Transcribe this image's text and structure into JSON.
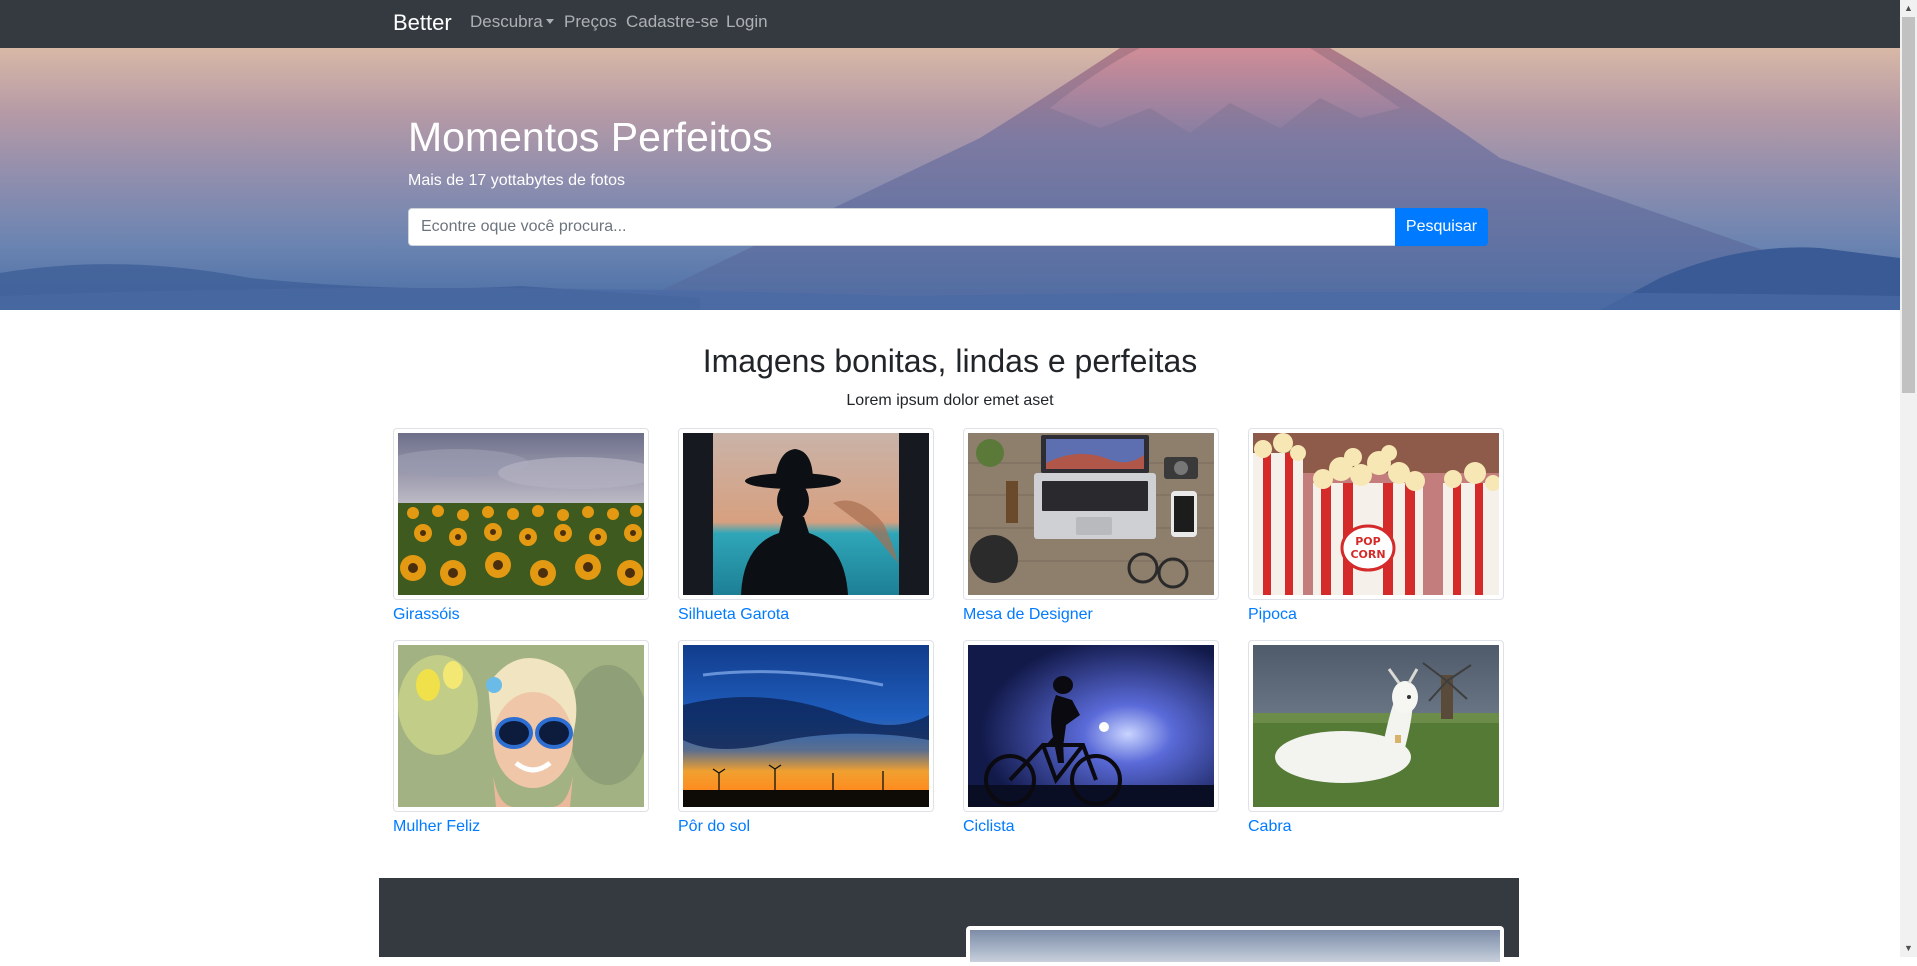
{
  "navbar": {
    "brand": "Better",
    "links": [
      {
        "label": "Descubra"
      },
      {
        "label": "Preços"
      },
      {
        "label": "Cadastre-se"
      },
      {
        "label": "Login"
      }
    ]
  },
  "hero": {
    "title": "Momentos Perfeitos",
    "subtitle": "Mais de 17 yottabytes de fotos",
    "search_placeholder": "Econtre oque você procura...",
    "search_button": "Pesquisar"
  },
  "gallery": {
    "title": "Imagens bonitas, lindas e perfeitas",
    "subtitle": "Lorem ipsum dolor emet aset",
    "items": [
      {
        "caption": "Girassóis"
      },
      {
        "caption": "Silhueta Garota"
      },
      {
        "caption": "Mesa de Designer"
      },
      {
        "caption": "Pipoca"
      },
      {
        "caption": "Mulher Feliz"
      },
      {
        "caption": "Pôr do sol"
      },
      {
        "caption": "Ciclista"
      },
      {
        "caption": "Cabra"
      }
    ]
  },
  "colors": {
    "navbar_bg": "#343a40",
    "link": "#007bff",
    "button": "#007bff"
  }
}
